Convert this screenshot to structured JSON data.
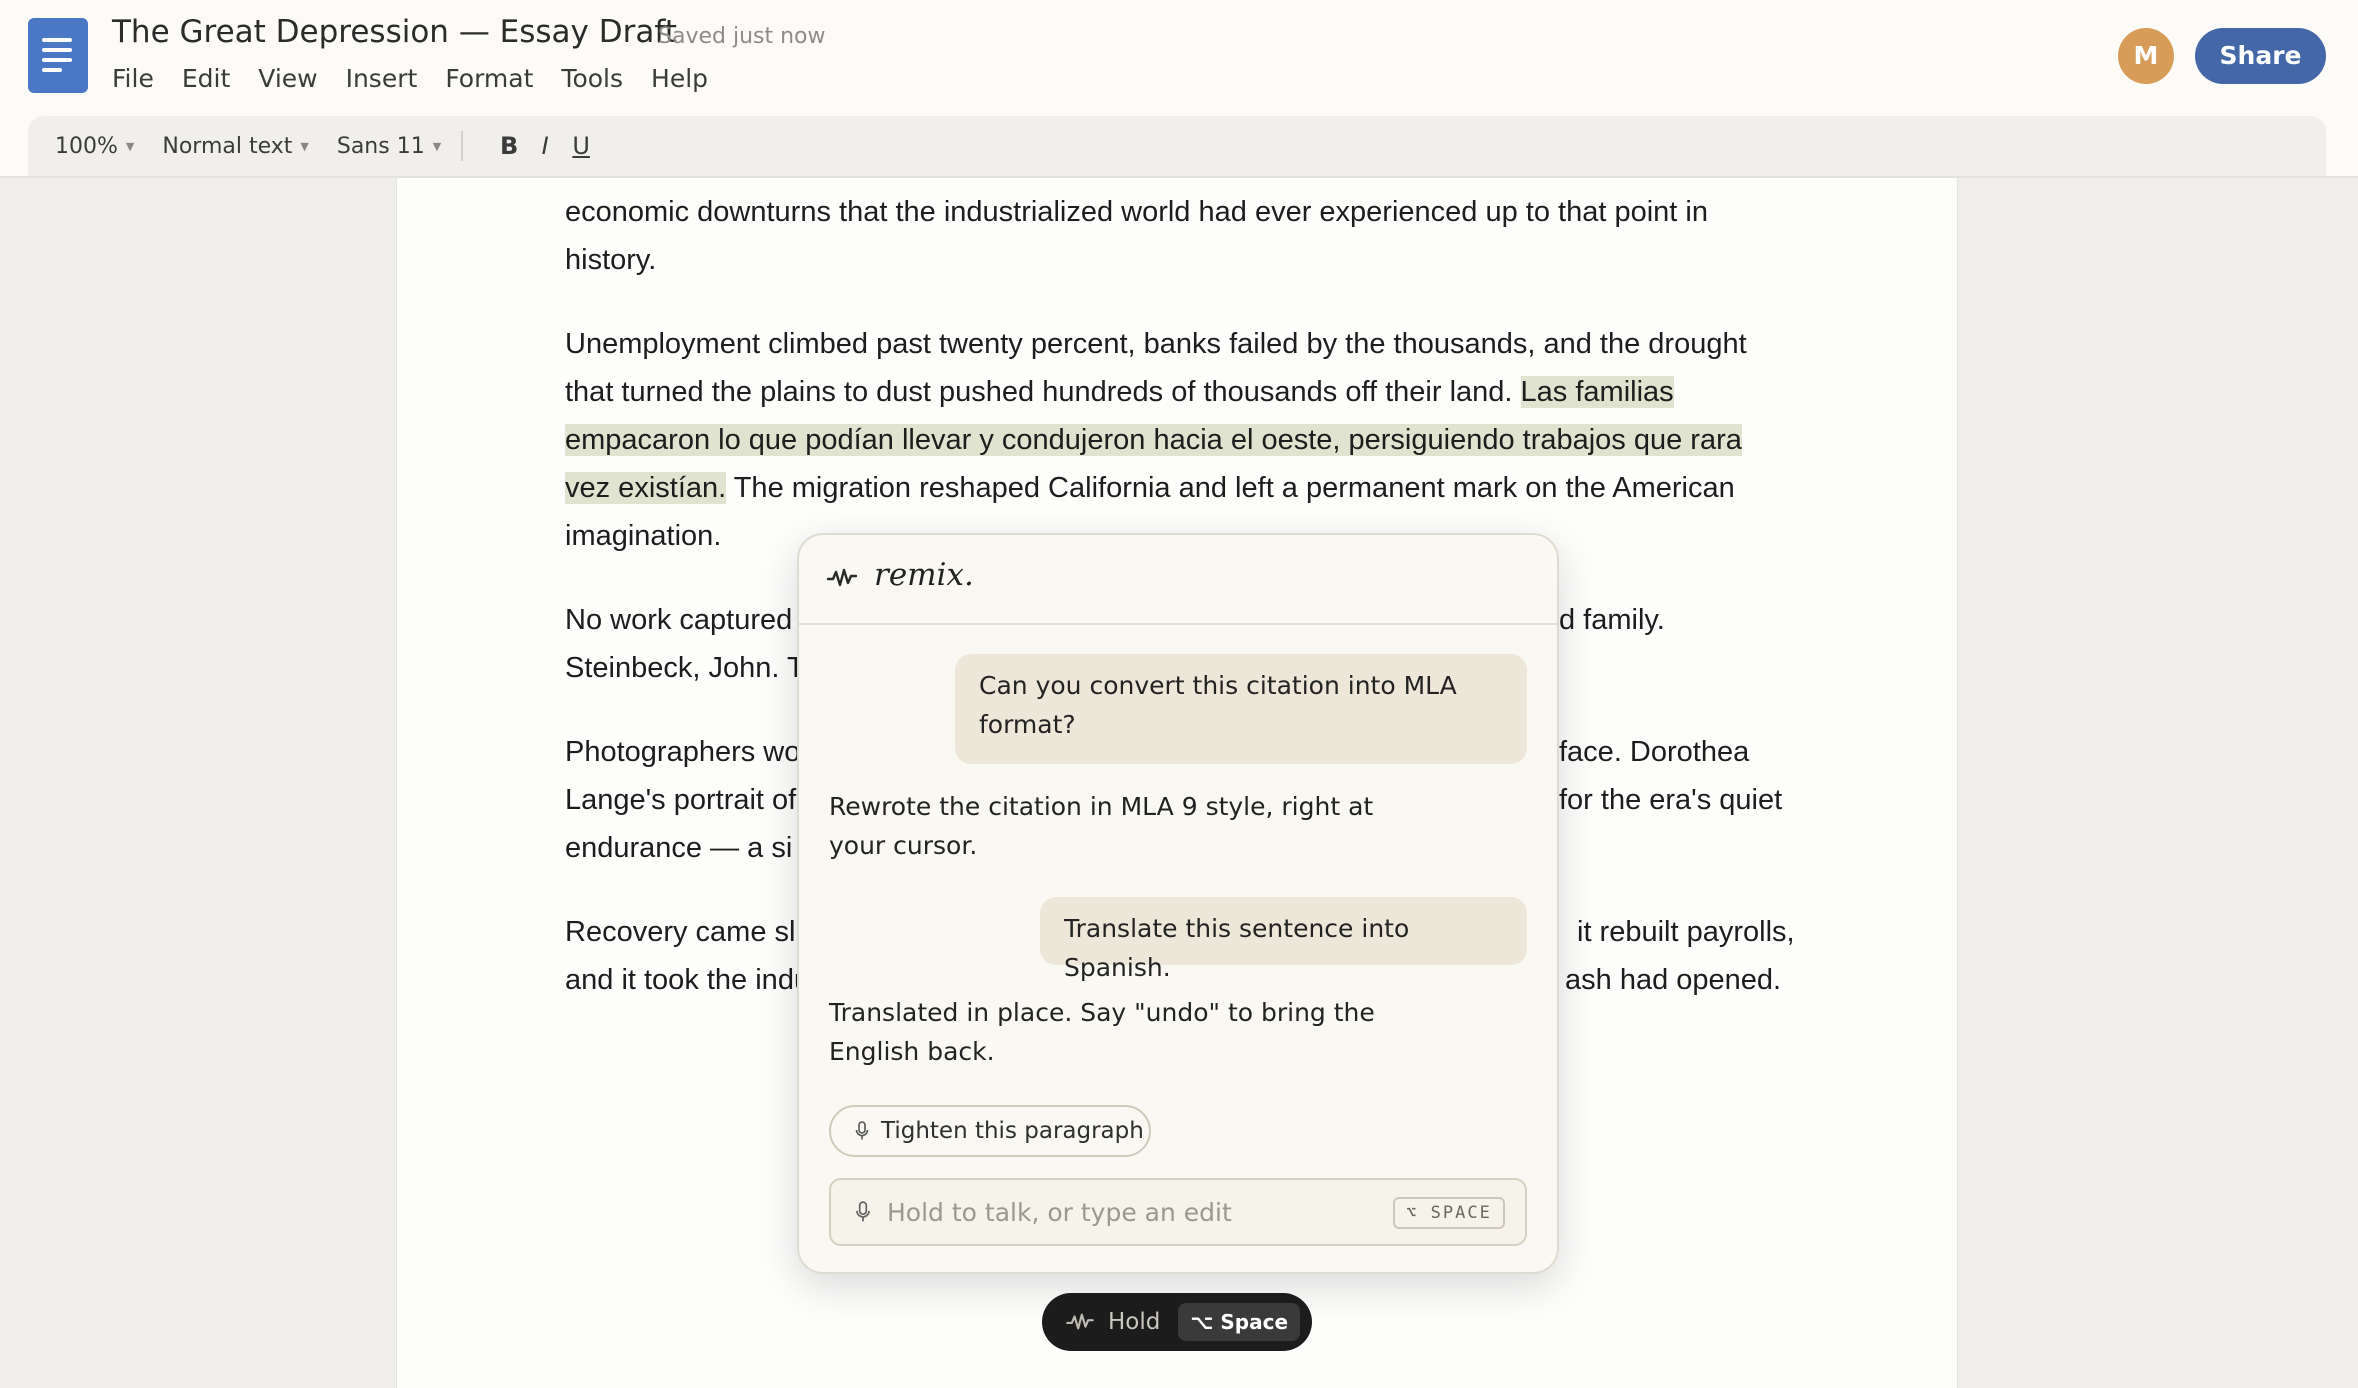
{
  "header": {
    "title": "The Great Depression — Essay Draft",
    "saved_status": "Saved just now",
    "menu": [
      "File",
      "Edit",
      "View",
      "Insert",
      "Format",
      "Tools",
      "Help"
    ],
    "avatar_initial": "M",
    "share_label": "Share",
    "brand_color": "#4467a8"
  },
  "toolbar": {
    "zoom": "100%",
    "style": "Normal text",
    "font": "Sans 11",
    "bold": "B",
    "italic": "I",
    "underline": "U"
  },
  "document": {
    "p1": {
      "line1": "economic downturns that the industrialized world had ever experienced up to that point in",
      "line2": "history."
    },
    "p2": {
      "line1": "Unemployment climbed past twenty percent, banks failed by the thousands, and the drought",
      "line2_plain": "that turned the plains to dust pushed hundreds of thousands off their land. ",
      "line2_highlight": "Las familias",
      "line3_highlight": "empacaron lo que podían llevar y condujeron hacia el oeste, persiguiendo trabajos que rara",
      "line4_highlight": "vez existían.",
      "line4_plain": " The migration reshaped California and left a permanent mark on the American",
      "line5": "imagination."
    },
    "p3": {
      "line1_left": "No work captured",
      "line1_right": "d family.",
      "line2_left": "Steinbeck, John. T"
    },
    "p4": {
      "line1_left": "Photographers wo",
      "line1_right": "face. Dorothea",
      "line2_left": "Lange's portrait of",
      "line2_right": "for the era's quiet",
      "line3_left": "endurance — a si"
    },
    "p5": {
      "line1_left": "Recovery came sl",
      "line1_right": "it rebuilt payrolls,",
      "line2_left": "and it took the indu",
      "line2_right": "ash had opened."
    }
  },
  "remix": {
    "brand": "remix.",
    "messages": {
      "user1": "Can you convert this citation into MLA format?",
      "reply1": "Rewrote the citation in MLA 9 style, right at your cursor.",
      "user2": "Translate this sentence into Spanish.",
      "reply2": "Translated in place. Say \"undo\" to bring the English back."
    },
    "suggestion_chip": "Tighten this paragraph",
    "input_placeholder": "Hold to talk, or type an edit",
    "shortcut_hint": "⌥ SPACE"
  },
  "hold_pill": {
    "label": "Hold",
    "key": "⌥ Space"
  }
}
